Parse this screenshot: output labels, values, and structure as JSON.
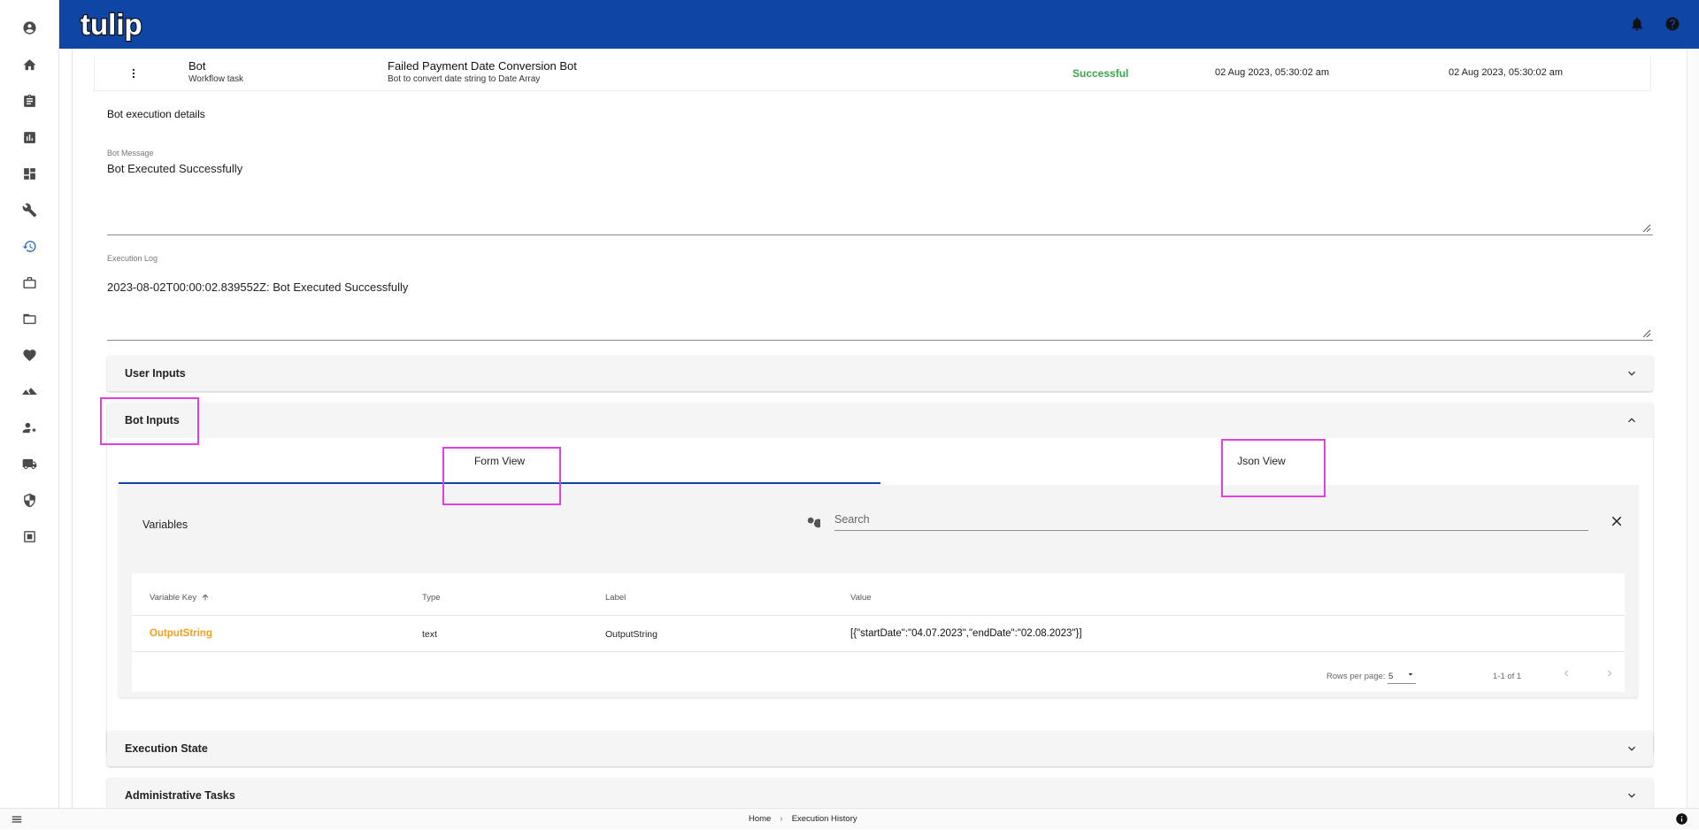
{
  "app": {
    "logo_text": "tulip",
    "brand_color": "#0f46a6"
  },
  "sidebar": {
    "items": [
      {
        "icon": "account-circle-icon"
      },
      {
        "icon": "home-icon"
      },
      {
        "icon": "clipboard-icon"
      },
      {
        "icon": "chart-icon"
      },
      {
        "icon": "dashboard-icon"
      },
      {
        "icon": "wrench-icon"
      },
      {
        "icon": "history-icon",
        "active": true
      },
      {
        "icon": "briefcase-icon"
      },
      {
        "icon": "folder-icon"
      },
      {
        "icon": "heart-icon"
      },
      {
        "icon": "terrain-icon"
      },
      {
        "icon": "user-settings-icon"
      },
      {
        "icon": "truck-icon"
      },
      {
        "icon": "shield-icon"
      },
      {
        "icon": "calendar-icon"
      }
    ]
  },
  "topbar": {
    "icons": [
      "bell-icon",
      "help-icon"
    ]
  },
  "task_row": {
    "type": "Bot",
    "type_sub": "Workflow task",
    "name": "Failed Payment Date Conversion Bot",
    "description": "Bot to convert date string to Date Array",
    "status": "Successful",
    "status_color": "#3aa64a",
    "start": "02 Aug 2023, 05:30:02 am",
    "end": "02 Aug 2023, 05:30:02 am"
  },
  "details": {
    "title": "Bot execution details",
    "bot_message_label": "Bot Message",
    "bot_message": "Bot Executed Successfully",
    "log_label": "Execution Log",
    "log": "2023-08-02T00:00:02.839552Z: Bot Executed Successfully"
  },
  "panels": {
    "user_inputs": "User Inputs",
    "bot_inputs": "Bot Inputs",
    "execution_state": "Execution State",
    "admin_tasks": "Administrative Tasks"
  },
  "tabs": {
    "form_view": "Form View",
    "json_view": "Json View"
  },
  "variables": {
    "title": "Variables",
    "search_placeholder": "Search",
    "columns": {
      "key": "Variable Key",
      "type": "Type",
      "label": "Label",
      "value": "Value"
    },
    "rows": [
      {
        "key": "OutputString",
        "type": "text",
        "label": "OutputString",
        "value": "[{\"startDate\":\"04.07.2023\",\"endDate\":\"02.08.2023\"}]"
      }
    ],
    "key_color": "#f0a020",
    "pager": {
      "rows_per_page_label": "Rows per page:",
      "rows_per_page": "5",
      "range": "1-1 of 1"
    }
  },
  "highlight_color": "#e040e0",
  "breadcrumb": {
    "home": "Home",
    "current": "Execution History"
  }
}
